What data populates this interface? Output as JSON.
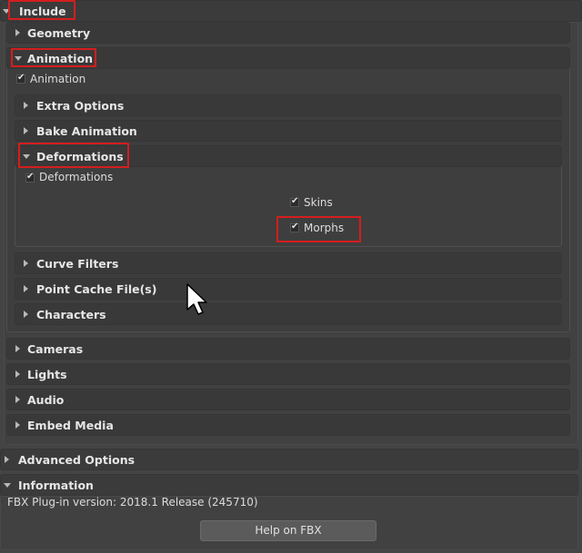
{
  "sections": {
    "include": "Include",
    "geometry": "Geometry",
    "animation": "Animation",
    "extra_options": "Extra Options",
    "bake_animation": "Bake Animation",
    "deformations": "Deformations",
    "curve_filters": "Curve Filters",
    "point_cache": "Point Cache File(s)",
    "characters": "Characters",
    "cameras": "Cameras",
    "lights": "Lights",
    "audio": "Audio",
    "embed_media": "Embed Media",
    "advanced_options": "Advanced Options",
    "information": "Information"
  },
  "checkboxes": {
    "animation": "Animation",
    "deformations": "Deformations",
    "skins": "Skins",
    "morphs": "Morphs"
  },
  "info": {
    "version_text": "FBX Plug-in version: 2018.1 Release (245710)",
    "help_button": "Help on FBX"
  },
  "colors": {
    "background": "#444444",
    "header": "#393939",
    "highlight": "#d51d1d"
  },
  "icons": {
    "expand": "triangle-right",
    "collapse": "triangle-down",
    "check": "check-mark",
    "cursor": "mouse-arrow"
  }
}
